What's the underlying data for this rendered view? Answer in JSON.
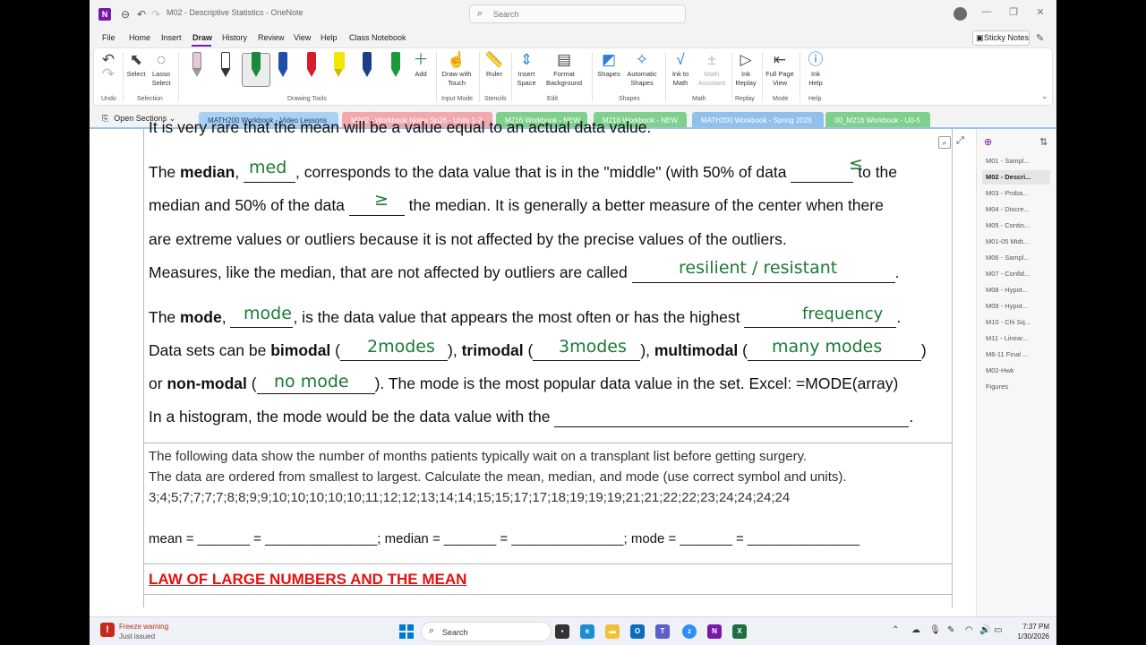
{
  "titlebar": {
    "title": "M02 - Descriptive Statistics - OneNote",
    "search_placeholder": "Search"
  },
  "menu": {
    "items": [
      "File",
      "Home",
      "Insert",
      "Draw",
      "History",
      "Review",
      "View",
      "Help",
      "Class Notebook"
    ],
    "active": "Draw",
    "sticky_notes": "Sticky Notes"
  },
  "ribbon": {
    "undo": "Undo",
    "select": "Select",
    "lasso": "Lasso\nSelect",
    "add": "Add",
    "draw_with_touch": "Draw with\nTouch",
    "ruler": "Ruler",
    "insert_space": "Insert\nSpace",
    "format_background": "Format\nBackground",
    "shapes": "Shapes",
    "automatic_shapes": "Automatic\nShapes",
    "ink_to_math": "Ink to\nMath",
    "math_assistant": "Math\nAssistant",
    "ink_replay": "Ink\nReplay",
    "full_page_view": "Full Page\nView",
    "ink_help": "Ink\nHelp",
    "groups": {
      "undo": "Undo",
      "selection": "Selection",
      "drawing_tools": "Drawing Tools",
      "input_mode": "Input Mode",
      "stencils": "Stencils",
      "edit": "Edit",
      "shapes": "Shapes",
      "math": "Math",
      "replay": "Replay",
      "mode": "Mode",
      "help": "Help"
    },
    "pen_colors": [
      "#e8c8d8",
      "#333333",
      "#1a8a3a",
      "#1f4fa8",
      "#d41f2a",
      "#f3e600",
      "#1a3f8a",
      "#1a9a3a"
    ]
  },
  "sections": {
    "open_sections": "Open Sections",
    "tabs": [
      {
        "label": "MATH200 Workbook - Video Lessons",
        "color": "#a9d1f5",
        "active": true
      },
      {
        "label": "M202 - Workbook Notes Sp26 - Units 1-2",
        "color": "#f3a8ad",
        "active": false
      },
      {
        "label": "M216 Workbook - NEW",
        "color": "#7fcf8d",
        "active": false
      },
      {
        "label": "M216 Workbook - NEW",
        "color": "#7fcf8d",
        "active": false
      },
      {
        "label": "MATH200 Workbook - Spring 2026",
        "color": "#8fc1ec",
        "active": false
      },
      {
        "label": "00_M216 Workbook - U0-5",
        "color": "#7fcf8d",
        "active": false
      }
    ]
  },
  "document": {
    "top_cut": "It is very rare that the mean will be a value equal to an actual data value.",
    "median_1a": "The",
    "median_1b": "median",
    "median_1c": ", corresponds to the data value that is in the \"middle\" (with 50% of data",
    "median_1d": "to the",
    "median_2a": "median and 50% of the data",
    "median_2b": "the median.  It is generally a better measure of the center when there",
    "median_3": "are extreme values or outliers because it is not affected by the precise values of the outliers.",
    "resilient_a": "Measures, like the median, that are not affected by outliers are called",
    "mode_1a": "The",
    "mode_1b": "mode",
    "mode_1c": ", is the data value that appears the most often or has the highest",
    "mode_2a": "Data sets can be",
    "mode_2b": "bimodal",
    "mode_2c": "trimodal",
    "mode_2d": "multimodal",
    "mode_3a": "or",
    "mode_3b": "non-modal",
    "mode_3c": ").  The mode is the most popular data value in the set.  Excel:  =MODE(array)",
    "hist": "In a histogram, the mode would be the data value with the",
    "ex_1": "The following data show the number of months patients typically wait on a transplant list before getting surgery.",
    "ex_2": "The data are ordered from smallest to largest. Calculate the mean, median, and mode (use correct symbol and units).",
    "ex_3": "3;4;5;7;7;7;7;8;8;9;9;10;10;10;10;10;11;12;12;13;14;14;15;15;17;17;18;19;19;19;21;21;22;22;23;24;24;24;24",
    "ex_4": "mean = _______ = _______________; median = _______ = _______________; mode = _______ = _______________",
    "law": "LAW OF LARGE NUMBERS AND THE MEAN"
  },
  "ink": {
    "med": "med",
    "le": "≤",
    "ge": "≥",
    "resilient": "resilient / resistant",
    "mode": "mode",
    "frequency": "frequency",
    "two_modes": "2modes",
    "three_modes": "3modes",
    "many_modes": "many modes",
    "no_mode": "no mode"
  },
  "pages": {
    "items": [
      "M01 - Sampl...",
      "M02 - Descri...",
      "M03 - Proba...",
      "M04 - Discre...",
      "M05 - Contin...",
      "M01-05 Midt...",
      "M06 - Sampl...",
      "M07 - Confid...",
      "M08 - Hypot...",
      "M09 - Hypot...",
      "M10 - Chi Sq...",
      "M11 - Linear...",
      "M6-11 Final ...",
      "M02-Hwk",
      "Figures"
    ],
    "active_index": 1
  },
  "taskbar": {
    "warn_title": "Freeze warning",
    "warn_sub": "Just issued",
    "search": "Search",
    "time": "7:37 PM",
    "date": "1/30/2026"
  }
}
